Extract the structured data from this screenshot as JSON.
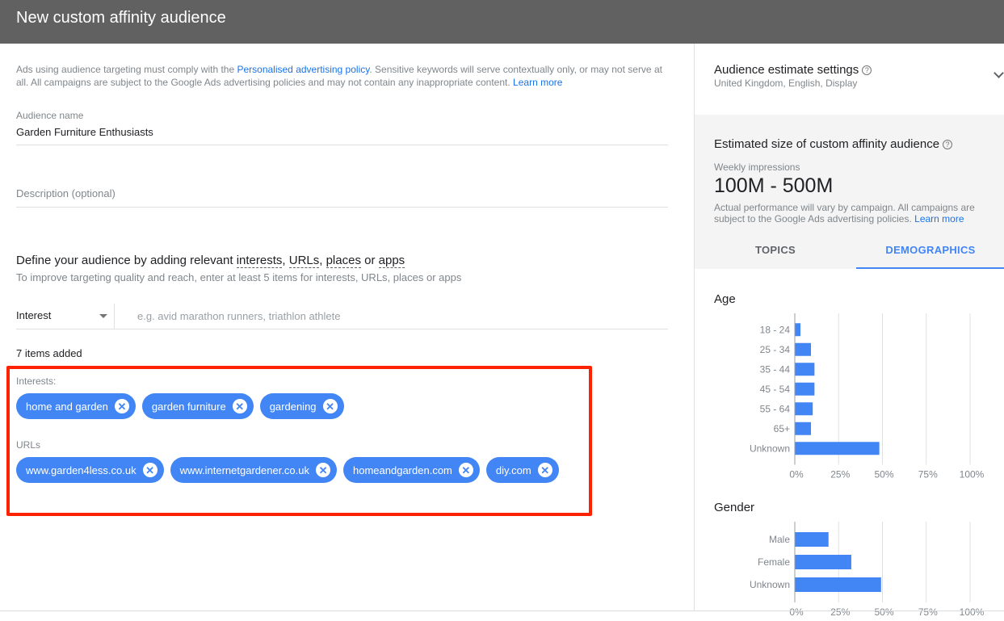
{
  "header": {
    "title": "New custom affinity audience"
  },
  "policy": {
    "text_before": "Ads using audience targeting must comply with the ",
    "policy_link": "Personalised advertising policy",
    "text_after": ". Sensitive keywords will serve contextually only, or may not serve at all. All campaigns are subject to the Google Ads advertising policies and may not contain any inappropriate content. ",
    "learn_more": "Learn more"
  },
  "audience_name": {
    "label": "Audience name",
    "value": "Garden Furniture Enthusiasts"
  },
  "description": {
    "placeholder": "Description (optional)"
  },
  "define": {
    "title_prefix": "Define your audience by adding relevant ",
    "term_interests": "interests",
    "sep1": ", ",
    "term_urls": "URLs",
    "sep2": ", ",
    "term_places": "places",
    "sep3": " or ",
    "term_apps": "apps",
    "subtitle": "To improve targeting quality and reach, enter at least 5 items for interests, URLs, places or apps"
  },
  "input_row": {
    "type_selected": "Interest",
    "placeholder": "e.g. avid marathon runners, triathlon athlete"
  },
  "items_added": "7 items added",
  "interests": {
    "label": "Interests:",
    "chips": [
      "home and garden",
      "garden furniture",
      "gardening"
    ]
  },
  "urls": {
    "label": "URLs",
    "chips": [
      "www.garden4less.co.uk",
      "www.internetgardener.co.uk",
      "homeandgarden.com",
      "diy.com"
    ]
  },
  "chip_remove_glyph": "✕",
  "side": {
    "settings_title": "Audience estimate settings",
    "settings_sub": "United Kingdom, English, Display",
    "help_glyph": "?",
    "estimate_title": "Estimated size of custom affinity audience",
    "weekly_label": "Weekly impressions",
    "weekly_value": "100M - 500M",
    "note": "Actual performance will vary by campaign. All campaigns are subject to the Google Ads advertising policies. ",
    "note_link": "Learn more",
    "tabs": [
      {
        "label": "TOPICS",
        "active": false
      },
      {
        "label": "DEMOGRAPHICS",
        "active": true
      }
    ]
  },
  "colors": {
    "accent": "#4285f4",
    "header": "#616161",
    "highlight": "#ff2200"
  },
  "chart_data": [
    {
      "type": "bar",
      "orientation": "horizontal",
      "title": "Age",
      "categories": [
        "18 - 24",
        "25 - 34",
        "35 - 44",
        "45 - 54",
        "55 - 64",
        "65+",
        "Unknown"
      ],
      "values": [
        3,
        9,
        11,
        11,
        10,
        9,
        48
      ],
      "xlim": [
        0,
        100
      ],
      "x_ticks": [
        "0%",
        "25%",
        "50%",
        "75%",
        "100%"
      ],
      "unit": "%",
      "grid": true
    },
    {
      "type": "bar",
      "orientation": "horizontal",
      "title": "Gender",
      "categories": [
        "Male",
        "Female",
        "Unknown"
      ],
      "values": [
        19,
        32,
        49
      ],
      "xlim": [
        0,
        100
      ],
      "x_ticks": [
        "0%",
        "25%",
        "50%",
        "75%",
        "100%"
      ],
      "unit": "%",
      "grid": true
    }
  ]
}
